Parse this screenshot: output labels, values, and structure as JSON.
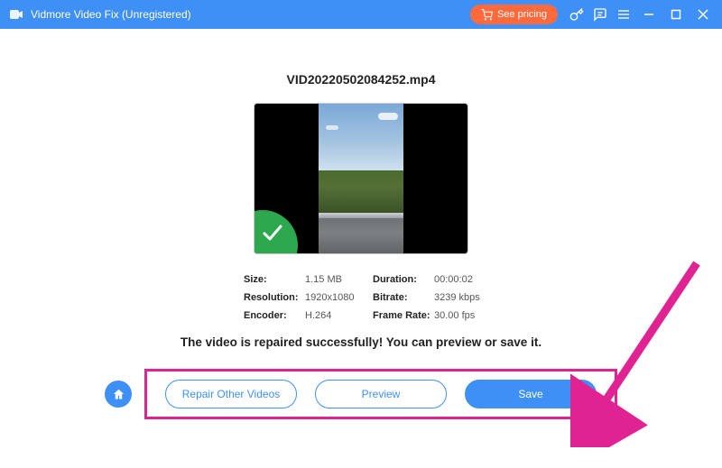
{
  "titlebar": {
    "app_name": "Vidmore Video Fix (Unregistered)",
    "pricing_label": "See pricing"
  },
  "file": {
    "name": "VID20220502084252.mp4"
  },
  "meta": {
    "size_label": "Size:",
    "size_value": "1.15 MB",
    "duration_label": "Duration:",
    "duration_value": "00:00:02",
    "resolution_label": "Resolution:",
    "resolution_value": "1920x1080",
    "bitrate_label": "Bitrate:",
    "bitrate_value": "3239 kbps",
    "encoder_label": "Encoder:",
    "encoder_value": "H.264",
    "framerate_label": "Frame Rate:",
    "framerate_value": "30.00 fps"
  },
  "status_message": "The video is repaired successfully! You can preview or save it.",
  "buttons": {
    "repair_other": "Repair Other Videos",
    "preview": "Preview",
    "save": "Save"
  }
}
